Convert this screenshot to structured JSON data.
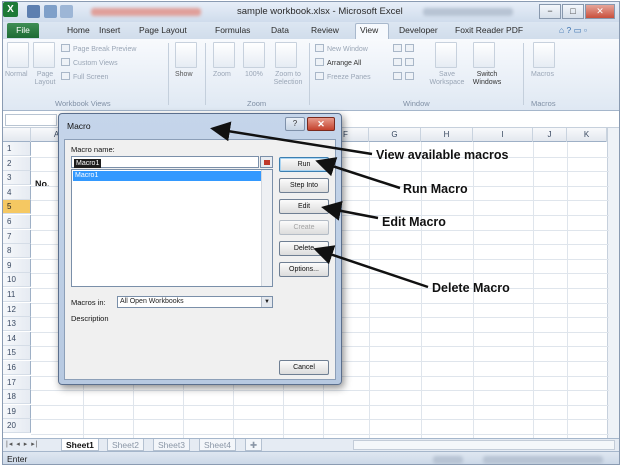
{
  "window": {
    "title": "sample workbook.xlsx - Microsoft Excel",
    "controls": {
      "minimize": "−",
      "maximize": "□",
      "close": "✕"
    }
  },
  "ribbon": {
    "tabs": [
      "File",
      "Home",
      "Insert",
      "Page Layout",
      "Formulas",
      "Data",
      "Review",
      "View",
      "Developer",
      "Foxit Reader PDF"
    ],
    "active_tab": "View",
    "groups": {
      "workbook_views": {
        "label": "Workbook Views",
        "normal": "Normal",
        "page_layout": "Page Layout",
        "page_break_preview": "Page Break Preview",
        "custom_views": "Custom Views",
        "full_screen": "Full Screen"
      },
      "show": {
        "label": "Show"
      },
      "zoom": {
        "label": "Zoom",
        "zoom": "Zoom",
        "zoom_100": "100%",
        "zoom_to_selection": "Zoom to Selection"
      },
      "window": {
        "label": "Window",
        "new_window": "New Window",
        "arrange_all": "Arrange All",
        "freeze_panes": "Freeze Panes",
        "save_workspace": "Save Workspace",
        "switch_windows": "Switch Windows"
      },
      "macros": {
        "label": "Macros",
        "macros": "Macros"
      }
    }
  },
  "grid": {
    "columns": [
      "A",
      "F",
      "G",
      "H",
      "I",
      "J",
      "K"
    ],
    "rows": [
      "1",
      "2",
      "3",
      "4",
      "5",
      "6",
      "7",
      "8",
      "9",
      "10",
      "11",
      "12",
      "13",
      "14",
      "15",
      "16",
      "17",
      "18",
      "19",
      "20"
    ],
    "selected_row": "5",
    "cells": {
      "A3": "No."
    }
  },
  "sheets": {
    "tabs": [
      "Sheet1",
      "Sheet2",
      "Sheet3",
      "Sheet4"
    ],
    "active": "Sheet1"
  },
  "status": {
    "mode": "Enter"
  },
  "dialog": {
    "title": "Macro",
    "help": "?",
    "close": "✕",
    "macro_name_label": "Macro name:",
    "macro_name_value": "Macro1",
    "macro_list": [
      "Macro1"
    ],
    "buttons": {
      "run": "Run",
      "step_into": "Step Into",
      "edit": "Edit",
      "create": "Create",
      "delete": "Delete",
      "options": "Options...",
      "cancel": "Cancel"
    },
    "macros_in_label": "Macros in:",
    "macros_in_value": "All Open Workbooks",
    "description_label": "Description"
  },
  "annotations": {
    "view_available": "View available macros",
    "run": "Run Macro",
    "edit": "Edit Macro",
    "delete": "Delete Macro"
  },
  "colors": {
    "file_tab": "#1d6b34",
    "selected_row": "#f5c862",
    "list_selection": "#3399ff",
    "dialog_frame": "#b7c9e1"
  }
}
